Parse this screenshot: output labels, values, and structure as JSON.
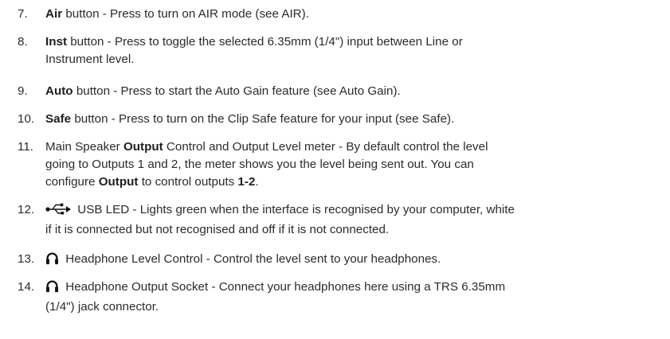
{
  "items": [
    {
      "num": "7.",
      "bold": "Air",
      "rest": " button - Press to turn on AIR mode (see AIR)."
    },
    {
      "num": "8.",
      "bold": "Inst",
      "rest1": " button - Press to toggle the selected 6.35mm (1/4\") input between Line or",
      "line2": "Instrument level."
    },
    {
      "num": "9.",
      "bold": "Auto",
      "rest": " button - Press to start the Auto Gain feature (see Auto Gain)."
    },
    {
      "num": "10.",
      "bold": "Safe",
      "rest": " button - Press to turn on the Clip Safe feature for your input (see Safe)."
    },
    {
      "num": "11.",
      "pre": "Main Speaker ",
      "bold1": "Output",
      "mid": " Control and Output Level meter - By default control the level",
      "line2": "going to Outputs 1 and 2, the meter shows you the level being sent out. You can",
      "line3_pre": "configure ",
      "bold2": "Output",
      "line3_mid": " to control outputs ",
      "bold3": "1",
      "dash": "-",
      "bold4": "2",
      "end": "."
    },
    {
      "num": "12.",
      "icon": "usb-icon",
      "rest1": " USB LED - Lights green when the interface is recognised by your computer, white",
      "line2": "if it is connected but not recognised and off if it is not connected."
    },
    {
      "num": "13.",
      "icon": "headphones-icon",
      "rest": " Headphone Level Control - Control the level sent to your headphones."
    },
    {
      "num": "14.",
      "icon": "headphones-icon",
      "rest1": " Headphone Output Socket - Connect your headphones here using a TRS 6.35mm",
      "line2": "(1/4\") jack connector."
    }
  ]
}
